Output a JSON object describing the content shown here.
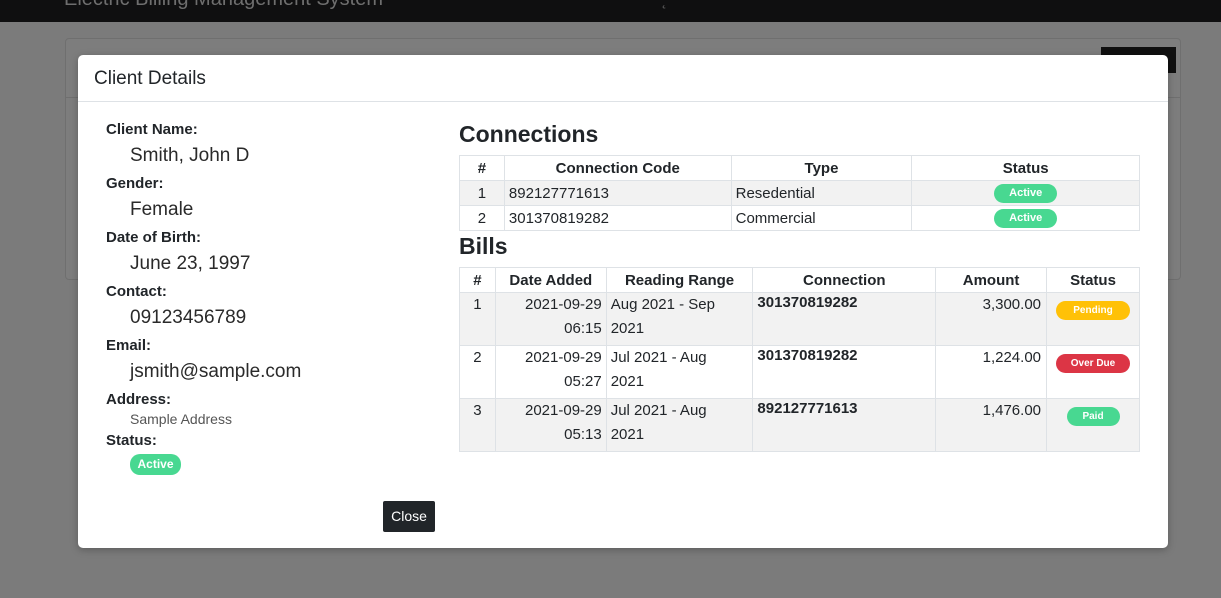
{
  "background": {
    "brand": "Electric Billing Management System"
  },
  "modal": {
    "title": "Client Details",
    "close_label": "Close"
  },
  "client": {
    "name_label": "Client Name:",
    "name": "Smith, John D",
    "gender_label": "Gender:",
    "gender": "Female",
    "dob_label": "Date of Birth:",
    "dob": "June 23, 1997",
    "contact_label": "Contact:",
    "contact": "09123456789",
    "email_label": "Email:",
    "email": "jsmith@sample.com",
    "address_label": "Address:",
    "address": "Sample Address",
    "status_label": "Status:",
    "status": "Active"
  },
  "connections": {
    "title": "Connections",
    "headers": [
      "#",
      "Connection Code",
      "Type",
      "Status"
    ],
    "rows": [
      {
        "num": "1",
        "code": "892127771613",
        "type": "Resedential",
        "status": "Active"
      },
      {
        "num": "2",
        "code": "301370819282",
        "type": "Commercial",
        "status": "Active"
      }
    ]
  },
  "bills": {
    "title": "Bills",
    "headers": [
      "#",
      "Date Added",
      "Reading Range",
      "Connection",
      "Amount",
      "Status"
    ],
    "rows": [
      {
        "num": "1",
        "date": "2021-09-29",
        "time": "06:15",
        "range1": "Aug 2021 - Sep",
        "range2": "2021",
        "connection": "301370819282",
        "amount": "3,300.00",
        "status": "Pending"
      },
      {
        "num": "2",
        "date": "2021-09-29",
        "time": "05:27",
        "range1": "Jul 2021 - Aug",
        "range2": "2021",
        "connection": "301370819282",
        "amount": "1,224.00",
        "status": "Over Due"
      },
      {
        "num": "3",
        "date": "2021-09-29",
        "time": "05:13",
        "range1": "Jul 2021 - Aug",
        "range2": "2021",
        "connection": "892127771613",
        "amount": "1,476.00",
        "status": "Paid"
      }
    ]
  },
  "colors": {
    "active": "#48d891",
    "pending": "#ffc107",
    "overdue": "#dc3545",
    "paid": "#48d891",
    "dark_button": "#212529"
  }
}
